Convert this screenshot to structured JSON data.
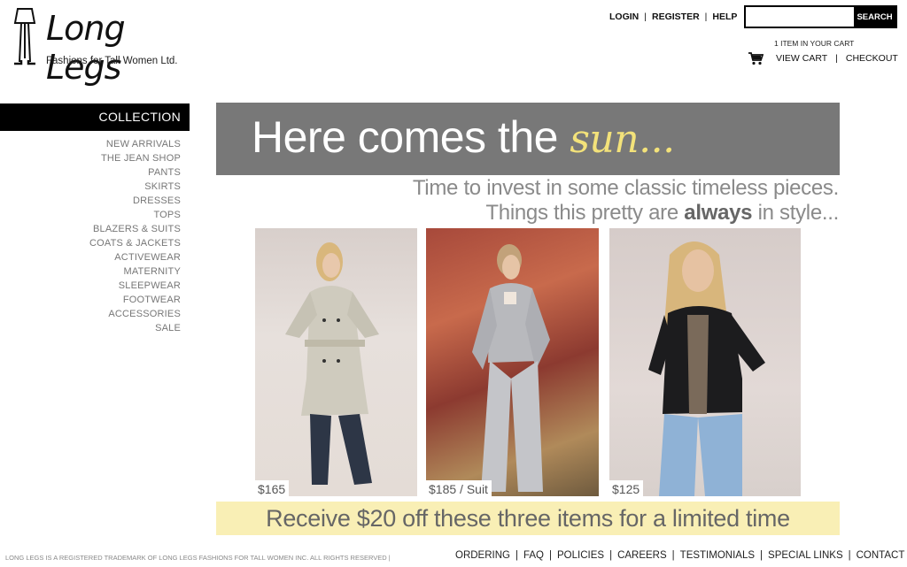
{
  "logo": {
    "name": "Long Legs",
    "tagline": "Fashions for Tall Women Ltd."
  },
  "header": {
    "links": [
      "LOGIN",
      "REGISTER",
      "HELP"
    ],
    "search_button": "SEARCH",
    "search_value": "",
    "cart_count_text": "1 ITEM IN YOUR CART",
    "view_cart": "VIEW CART",
    "checkout": "CHECKOUT"
  },
  "sidebar": {
    "title": "COLLECTION",
    "items": [
      "NEW ARRIVALS",
      "THE JEAN SHOP",
      "PANTS",
      "SKIRTS",
      "DRESSES",
      "TOPS",
      "BLAZERS & SUITS",
      "COATS & JACKETS",
      "ACTIVEWEAR",
      "MATERNITY",
      "SLEEPWEAR",
      "FOOTWEAR",
      "ACCESSORIES",
      "SALE"
    ]
  },
  "hero": {
    "text": "Here comes the",
    "script": "sun..."
  },
  "tagline": {
    "line1": "Time to invest in some classic timeless pieces.",
    "line2_pre": "Things this pretty are",
    "line2_bold": "always",
    "line2_post": "in style..."
  },
  "products": [
    {
      "price": "$165"
    },
    {
      "price": "$185 / Suit"
    },
    {
      "price": "$125"
    }
  ],
  "promo": "Receive $20 off these three items for a limited time",
  "footer": {
    "trademark": "LONG LEGS IS A REGISTERED TRADEMARK OF LONG LEGS FASHIONS FOR TALL WOMEN INC. ALL RIGHTS RESERVED",
    "links": [
      "ORDERING",
      "FAQ",
      "POLICIES",
      "CAREERS",
      "TESTIMONIALS",
      "SPECIAL LINKS",
      "CONTACT US"
    ]
  },
  "colors": {
    "hero_bg": "#787878",
    "script_yellow": "#f3e27a",
    "promo_bg": "#f9efb5",
    "sidebar_bar": "#000000"
  }
}
